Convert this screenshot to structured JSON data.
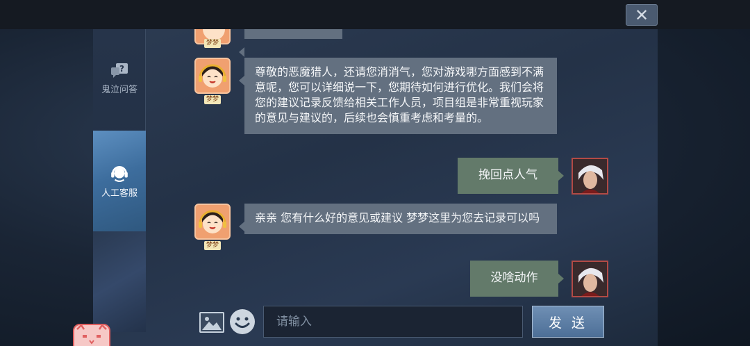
{
  "window": {
    "close_label": "✕"
  },
  "sidebar": {
    "items": [
      {
        "label": "鬼泣问答",
        "icon": "question-bubble-icon",
        "active": false
      },
      {
        "label": "人工客服",
        "icon": "headset-agent-icon",
        "active": true
      }
    ]
  },
  "messages": [
    {
      "from": "agent",
      "name": "梦梦",
      "text": ""
    },
    {
      "from": "agent",
      "name": "梦梦",
      "text": "尊敬的恶魔猎人，还请您消消气，您对游戏哪方面感到不满意呢，您可以详细说一下，您期待如何进行优化。我们会将您的建议记录反馈给相关工作人员，项目组是非常重视玩家的意见与建议的，后续也会慎重考虑和考量的。"
    },
    {
      "from": "user",
      "text": "挽回点人气"
    },
    {
      "from": "agent",
      "name": "梦梦",
      "text": "亲亲 您有什么好的意见或建议 梦梦这里为您去记录可以吗"
    },
    {
      "from": "user",
      "text": "没啥动作"
    }
  ],
  "composer": {
    "image_icon": "image-icon",
    "emoji_icon": "emoji-icon",
    "placeholder": "请输入",
    "value": "",
    "send_label": "发 送"
  },
  "colors": {
    "agent_bubble": "#637080",
    "user_bubble": "#637a6a",
    "active_tab": "#4f7fae"
  }
}
